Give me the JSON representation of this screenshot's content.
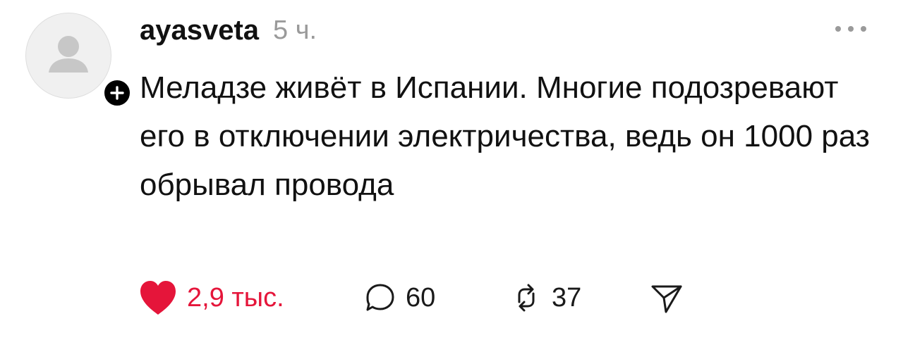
{
  "post": {
    "username": "ayasveta",
    "time": "5 ч.",
    "text": "Меладзе живёт в Испании. Многие подозревают его в отключении электричества, ведь он 1000 раз обрывал провода"
  },
  "actions": {
    "likes": "2,9 тыс.",
    "replies": "60",
    "reposts": "37"
  },
  "icons": {
    "more": "more-horizontal-icon",
    "like": "heart-icon",
    "reply": "comment-bubble-icon",
    "repost": "repost-arrows-icon",
    "share": "send-icon",
    "follow": "plus-icon",
    "avatar": "default-user-icon"
  },
  "colors": {
    "like_accent": "#e5153a",
    "muted_text": "#9a9a9a",
    "avatar_bg": "#f0f0f0"
  }
}
